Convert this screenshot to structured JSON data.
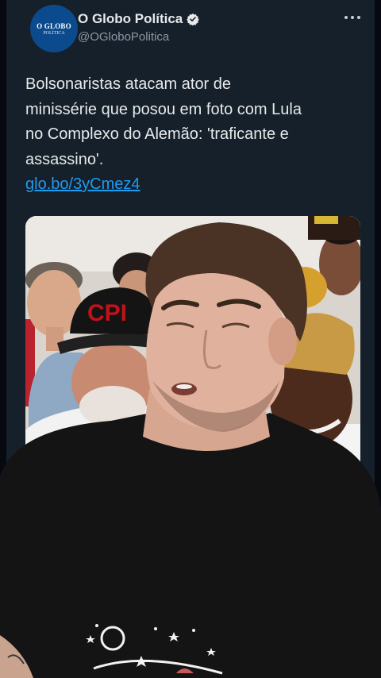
{
  "tweet": {
    "author_name": "O Globo Política",
    "author_handle": "@OGloboPolitica",
    "avatar_logo_main": "O GLOBO",
    "avatar_logo_sub": "POLÍTICA",
    "text": "Bolsonaristas atacam ator de\nminissérie que posou em foto com Lula\nno Complexo do Alemão: 'traficante e\nassassino'.",
    "link": "glo.bo/3yCmez4",
    "cap_text": "CPI"
  },
  "colors": {
    "tweet_background": "#15202b",
    "link": "#1d9bf0",
    "verified": "#e7e9ea",
    "avatar_background": "#0b4a8c",
    "cap_text": "#c0121a"
  },
  "icons": {
    "verified": "verified-badge-icon",
    "more": "more-options-icon"
  }
}
